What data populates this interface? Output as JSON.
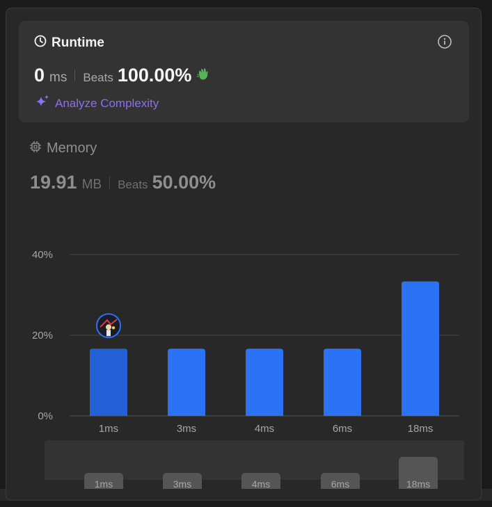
{
  "runtime": {
    "title": "Runtime",
    "value": "0",
    "unit": "ms",
    "beats_label": "Beats",
    "beats_value": "100.00%",
    "analyze_label": "Analyze Complexity"
  },
  "memory": {
    "title": "Memory",
    "value": "19.91",
    "unit": "MB",
    "beats_label": "Beats",
    "beats_value": "50.00%"
  },
  "icons": [
    "clock-icon",
    "info-icon",
    "clap-hands-icon",
    "sparkle-icon",
    "chip-icon"
  ],
  "colors": {
    "accent_purple": "#8c6df2",
    "bar_blue": "#2b72f5",
    "bar_selected": "#2460d6",
    "clap_green": "#4caf50"
  },
  "chart_data": {
    "type": "bar",
    "categories": [
      "1ms",
      "3ms",
      "4ms",
      "6ms",
      "18ms"
    ],
    "values": [
      16.67,
      16.67,
      16.67,
      16.67,
      33.33
    ],
    "y_tick_labels": [
      "0%",
      "20%",
      "40%"
    ],
    "y_ticks": [
      0,
      20,
      40
    ],
    "ylim": [
      0,
      40
    ],
    "grid": true,
    "highlighted_category": "1ms"
  },
  "overview": {
    "labels": [
      "1ms",
      "3ms",
      "4ms",
      "6ms",
      "18ms"
    ]
  }
}
